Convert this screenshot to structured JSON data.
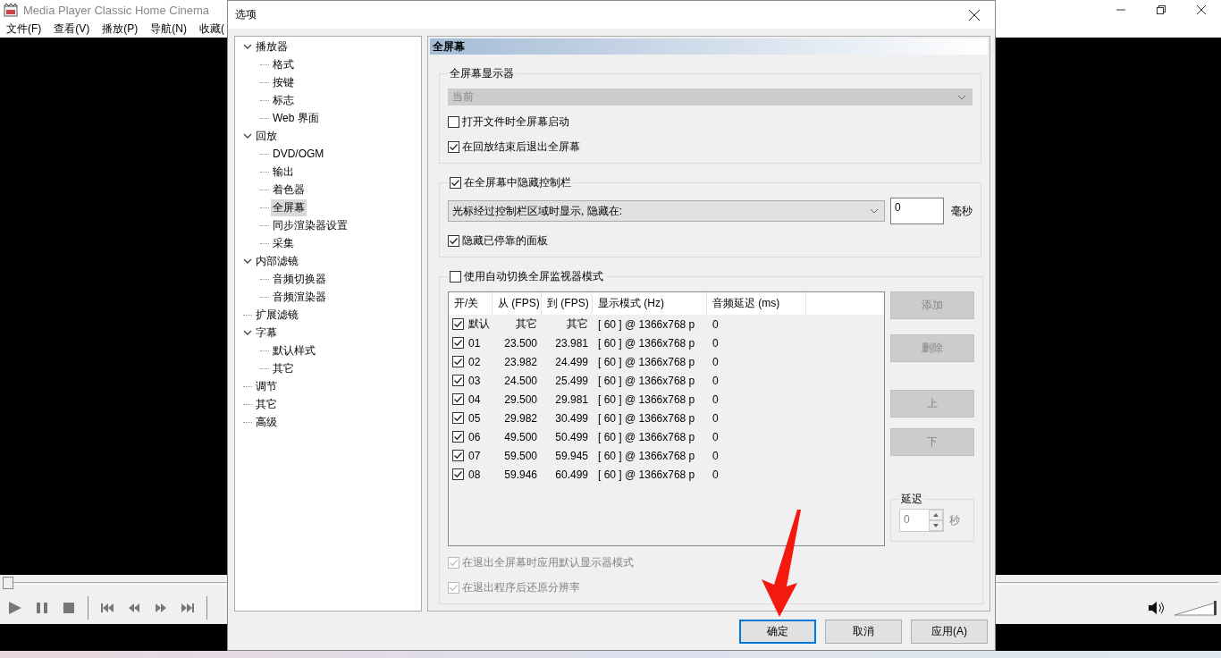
{
  "app": {
    "title": "Media Player Classic Home Cinema",
    "menu": [
      "文件(F)",
      "查看(V)",
      "播放(P)",
      "导航(N)",
      "收藏("
    ],
    "seek": {
      "level": 0
    },
    "volume": {
      "level": 1
    }
  },
  "dialog": {
    "title": "选项",
    "tree": [
      {
        "label": "播放器",
        "expanded": true,
        "selected": false,
        "children": [
          {
            "label": "格式",
            "selected": false
          },
          {
            "label": "按键",
            "selected": false
          },
          {
            "label": "标志",
            "selected": false
          },
          {
            "label": "Web 界面",
            "selected": false
          }
        ]
      },
      {
        "label": "回放",
        "expanded": true,
        "selected": false,
        "children": [
          {
            "label": "DVD/OGM",
            "selected": false
          },
          {
            "label": "输出",
            "selected": false
          },
          {
            "label": "着色器",
            "selected": false
          },
          {
            "label": "全屏幕",
            "selected": true
          },
          {
            "label": "同步渲染器设置",
            "selected": false
          },
          {
            "label": "采集",
            "selected": false
          }
        ]
      },
      {
        "label": "内部滤镜",
        "expanded": true,
        "selected": false,
        "children": [
          {
            "label": "音频切换器",
            "selected": false
          },
          {
            "label": "音频渲染器",
            "selected": false
          }
        ]
      },
      {
        "label": "扩展滤镜",
        "selected": false
      },
      {
        "label": "字幕",
        "expanded": true,
        "selected": false,
        "children": [
          {
            "label": "默认样式",
            "selected": false
          },
          {
            "label": "其它",
            "selected": false
          }
        ]
      },
      {
        "label": "调节",
        "selected": false
      },
      {
        "label": "其它",
        "selected": false
      },
      {
        "label": "高级",
        "selected": false
      }
    ],
    "page": {
      "heading": "全屏幕",
      "monitor_group": {
        "title": "全屏幕显示器",
        "monitor": {
          "value": "当前",
          "disabled": true
        },
        "options": [
          {
            "label": "打开文件时全屏幕启动",
            "checked": false
          },
          {
            "label": "在回放结束后退出全屏幕",
            "checked": true
          }
        ]
      },
      "hide_controls_group": {
        "label": "在全屏幕中隐藏控制栏",
        "checked": true,
        "mode": {
          "value": "光标经过控制栏区域时显示, 隐藏在:"
        },
        "delay": {
          "value": "0",
          "unit": "毫秒"
        },
        "options": [
          {
            "label": "隐藏已停靠的面板",
            "checked": true
          }
        ]
      },
      "auto_switch_group": {
        "label": "使用自动切换全屏监视器模式",
        "checked": false,
        "table": {
          "columns": [
            "开/关",
            "从 (FPS)",
            "到 (FPS)",
            "显示模式 (Hz)",
            "音频延迟 (ms)"
          ],
          "rows": [
            {
              "checked": true,
              "cells": [
                "默认",
                "其它",
                "其它",
                "[ 60 ] @ 1366x768 p",
                "0"
              ]
            },
            {
              "checked": true,
              "cells": [
                "01",
                "23.500",
                "23.981",
                "[ 60 ] @ 1366x768 p",
                "0"
              ]
            },
            {
              "checked": true,
              "cells": [
                "02",
                "23.982",
                "24.499",
                "[ 60 ] @ 1366x768 p",
                "0"
              ]
            },
            {
              "checked": true,
              "cells": [
                "03",
                "24.500",
                "25.499",
                "[ 60 ] @ 1366x768 p",
                "0"
              ]
            },
            {
              "checked": true,
              "cells": [
                "04",
                "29.500",
                "29.981",
                "[ 60 ] @ 1366x768 p",
                "0"
              ]
            },
            {
              "checked": true,
              "cells": [
                "05",
                "29.982",
                "30.499",
                "[ 60 ] @ 1366x768 p",
                "0"
              ]
            },
            {
              "checked": true,
              "cells": [
                "06",
                "49.500",
                "50.499",
                "[ 60 ] @ 1366x768 p",
                "0"
              ]
            },
            {
              "checked": true,
              "cells": [
                "07",
                "59.500",
                "59.945",
                "[ 60 ] @ 1366x768 p",
                "0"
              ]
            },
            {
              "checked": true,
              "cells": [
                "08",
                "59.946",
                "60.499",
                "[ 60 ] @ 1366x768 p",
                "0"
              ]
            }
          ]
        },
        "buttons": [
          {
            "label": "添加",
            "disabled": true
          },
          {
            "label": "删除",
            "disabled": true
          },
          {
            "label": "上",
            "disabled": true
          },
          {
            "label": "下",
            "disabled": true
          }
        ],
        "delay_group": {
          "title": "延迟",
          "value": "0",
          "unit": "秒",
          "disabled": true
        }
      },
      "footer_options": [
        {
          "label": "在退出全屏幕时应用默认显示器模式",
          "checked": true,
          "disabled": true
        },
        {
          "label": "在退出程序后还原分辨率",
          "checked": true,
          "disabled": true
        }
      ]
    },
    "buttons": [
      {
        "label": "确定",
        "default": true
      },
      {
        "label": "取消",
        "default": false
      },
      {
        "label": "应用(A)",
        "default": false
      }
    ]
  }
}
